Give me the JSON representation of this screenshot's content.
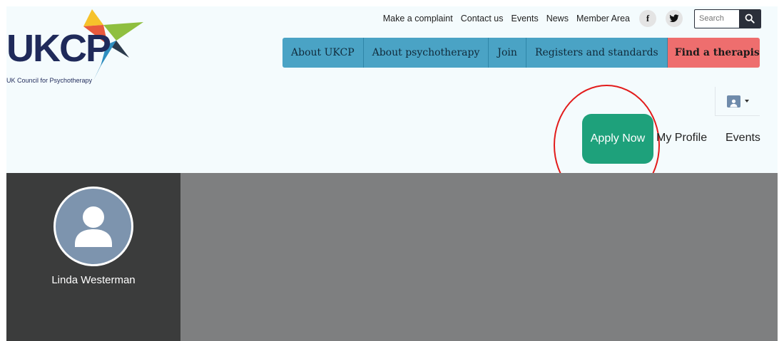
{
  "logo": {
    "wordmark": "UKCP",
    "tagline": "UK Council for Psychotherapy"
  },
  "top_links": [
    "Make a complaint",
    "Contact us",
    "Events",
    "News",
    "Member Area"
  ],
  "social": {
    "facebook": "f",
    "twitter_icon": "twitter-bird-icon"
  },
  "search": {
    "placeholder": "Search",
    "icon": "search-icon"
  },
  "main_nav": [
    "About UKCP",
    "About psychotherapy",
    "Join",
    "Registers and standards",
    "Find a therapist"
  ],
  "user_menu": {
    "icon": "user-icon"
  },
  "actions": {
    "apply_now": "Apply Now",
    "my_profile": "My Profile",
    "events": "Events"
  },
  "profile": {
    "name": "Linda Westerman"
  },
  "colors": {
    "nav_blue": "#4aa3c5",
    "find_therapist_red": "#ee6e6e",
    "apply_green": "#1ea17b",
    "highlight_circle": "#e21b1b",
    "sidebar_dark": "#3b3c3c",
    "content_gray": "#7e7f80"
  }
}
